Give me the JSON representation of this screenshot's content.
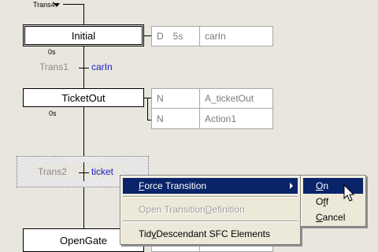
{
  "diagram": {
    "trans0": {
      "label": "Trans4"
    },
    "initial_step": {
      "name": "Initial",
      "time": "0s"
    },
    "initial_actions": [
      {
        "qualifier": "D",
        "time": "5s",
        "action": "carIn"
      }
    ],
    "trans1": {
      "label": "Trans1",
      "condition": "carIn"
    },
    "ticketout_step": {
      "name": "TicketOut",
      "time": "0s"
    },
    "ticketout_actions": [
      {
        "qualifier": "N",
        "action": "A_ticketOut"
      },
      {
        "qualifier": "N",
        "action": "Action1"
      }
    ],
    "trans2": {
      "label": "Trans2",
      "condition": "ticket"
    },
    "opengate_step": {
      "name": "OpenGate"
    }
  },
  "context_menu": {
    "items": [
      {
        "pre": "",
        "u": "F",
        "post": "orce Transition",
        "state": "highlighted"
      },
      {
        "pre": "Open Transition ",
        "u": "D",
        "post": "efinition",
        "state": "disabled"
      },
      {
        "pre": "Tid",
        "u": "y",
        "post": " Descendant SFC Elements",
        "state": "normal"
      }
    ]
  },
  "submenu": {
    "items": [
      {
        "pre": "",
        "u": "O",
        "post": "n",
        "state": "highlighted"
      },
      {
        "pre": "O",
        "u": "f",
        "post": "f",
        "state": "normal"
      },
      {
        "pre": "",
        "u": "C",
        "post": "ancel",
        "state": "normal"
      }
    ]
  },
  "colors": {
    "canvas": "#e8e6de",
    "menu_highlight": "#0a246a",
    "condition_text": "#1c1cc8",
    "disabled_text": "#a0a0a0"
  }
}
